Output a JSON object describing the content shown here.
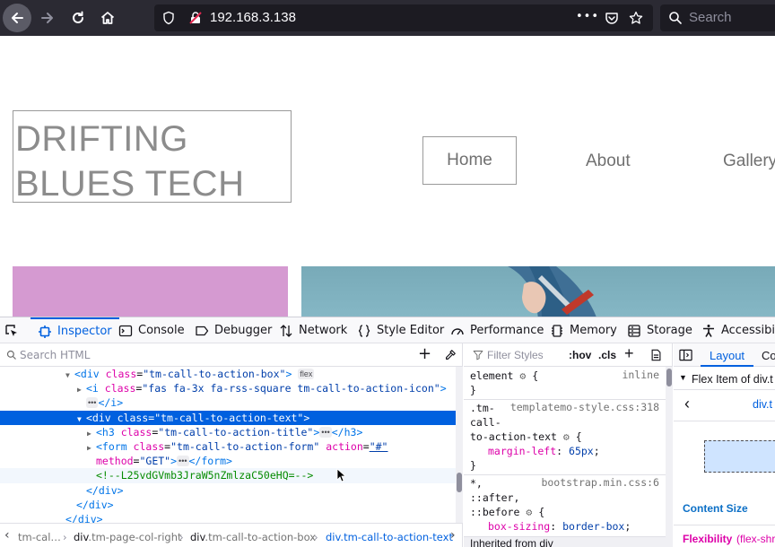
{
  "browser": {
    "url": "192.168.3.138",
    "search_placeholder": "Search",
    "overflow_glyph": "•••"
  },
  "page": {
    "logo": "DRIFTING\nBLUES TECH",
    "nav": {
      "home": "Home",
      "about": "About",
      "gallery": "Gallery"
    },
    "colors": {
      "purple_block": "#d59ad1",
      "hero": "#7fb1bf"
    }
  },
  "devtools": {
    "tabs": {
      "inspector": "Inspector",
      "console": "Console",
      "debugger": "Debugger",
      "network": "Network",
      "style_editor": "Style Editor",
      "performance": "Performance",
      "memory": "Memory",
      "storage": "Storage",
      "accessibility": "Accessibili"
    },
    "markup": {
      "search_placeholder": "Search HTML",
      "lines": {
        "l1": {
          "open": "<div ",
          "a1": "class",
          "v1": "\"tm-call-to-action-box\"",
          "close": ">",
          "pill": "flex"
        },
        "l2": {
          "open": "<i ",
          "a1": "class",
          "v1": "\"fas fa-3x fa-rss-square tm-call-to-action-icon\"",
          "close": ">"
        },
        "l3": {
          "pill": "•••",
          "close": "</i>"
        },
        "l4": {
          "open": "<div ",
          "a1": "class",
          "v1": "\"tm-call-to-action-text\"",
          "close": ">"
        },
        "l5": {
          "open": "<h3 ",
          "a1": "class",
          "v1": "\"tm-call-to-action-title\"",
          "close": ">",
          "pill": "•••",
          "end": "</h3>"
        },
        "l6": {
          "open": "<form ",
          "a1": "class",
          "v1": "\"tm-call-to-action-form\"",
          "a2": "action",
          "v2": "\"#\""
        },
        "l7": {
          "a3": "method",
          "v3": "\"GET\"",
          "close": ">",
          "pill": "•••",
          "end": "</form>"
        },
        "l8": {
          "comment": "<!--L25vdGVmb3JraW5nZmlzaC50eHQ=-->"
        },
        "l9": {
          "end": "</div>"
        },
        "l10": {
          "end": "</div>"
        },
        "l11": {
          "end": "</div>"
        }
      }
    },
    "breadcrumbs": {
      "c1": "tm-cal…",
      "c2a": "div",
      "c2b": ".tm-page-col-right",
      "c3a": "div",
      "c3b": ".tm-call-to-action-box",
      "c4": "div.tm-call-to-action-text"
    },
    "rules": {
      "filter_placeholder": "Filter Styles",
      "hov": ":hov",
      "cls": ".cls",
      "r1_selector": "element",
      "r1_source": "inline",
      "r2_sel1": ".tm-",
      "r2_source": "templatemo-style.css:318",
      "r2_sel2": "call-",
      "r2_sel3": "to-action-text",
      "r2_prop": "margin-left",
      "r2_val": "65px",
      "r3_sel1": "*,",
      "r3_source": "bootstrap.min.css:6",
      "r3_sel2": "::after,",
      "r3_sel3": "::before",
      "r3_prop": "box-sizing",
      "r3_val": "border-box",
      "inherited": "Inherited from div"
    },
    "layout": {
      "tab_layout": "Layout",
      "tab_computed": "Co",
      "flex_item": "Flex Item of div.t",
      "div_link": "div.t",
      "content_size": "Content Size",
      "flexibility": "Flexibility",
      "flexibility_val": "(flex-shr"
    }
  }
}
